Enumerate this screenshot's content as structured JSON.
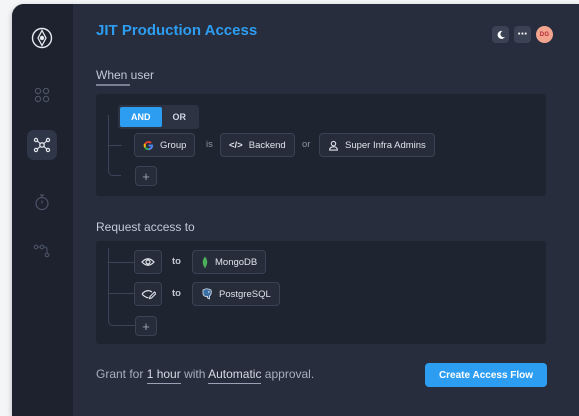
{
  "header": {
    "title": "JIT Production Access",
    "avatar_initials": "DG",
    "more_label": "⋯"
  },
  "sidebar": {
    "items": [
      {
        "icon": "logo-icon"
      },
      {
        "icon": "apps-icon"
      },
      {
        "icon": "network-icon",
        "active": true
      },
      {
        "icon": "timer-icon"
      },
      {
        "icon": "flow-icon"
      }
    ]
  },
  "when_user": {
    "label": "When user",
    "operators": [
      "AND",
      "OR"
    ],
    "selected_operator": "AND",
    "condition": {
      "provider_label": "Group",
      "is_label": "is",
      "value_label": "Backend",
      "or_label": "or",
      "value2_label": "Super Infra Admins"
    },
    "add_label": "+"
  },
  "request": {
    "label": "Request access to",
    "items": [
      {
        "icon": "eye-icon",
        "to_label": "to",
        "resource": "MongoDB"
      },
      {
        "icon": "edit-eye-icon",
        "to_label": "to",
        "resource": "PostgreSQL"
      }
    ],
    "add_label": "+"
  },
  "footer": {
    "grant_prefix": "Grant for",
    "duration": "1 hour",
    "with_label": "with",
    "approval": "Automatic",
    "approval_suffix": "approval.",
    "cta_label": "Create Access Flow"
  },
  "colors": {
    "accent": "#2d9df2",
    "background": "#272d3c",
    "panel": "#1f2431",
    "sidebar": "#1d222e"
  }
}
